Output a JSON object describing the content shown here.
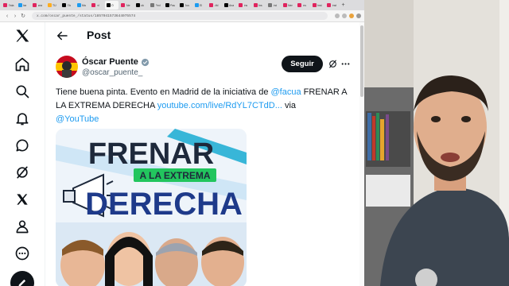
{
  "browser": {
    "tabs": [
      {
        "label": "Esta",
        "color": "#e0245e"
      },
      {
        "label": "las",
        "color": "#1d9bf0"
      },
      {
        "label": "sea",
        "color": "#e0245e"
      },
      {
        "label": "TÚ",
        "color": "#ffad1f"
      },
      {
        "label": "Elc",
        "color": "#000000"
      },
      {
        "label": "Ma",
        "color": "#1d9bf0"
      },
      {
        "label": "rd",
        "color": "#e0245e"
      },
      {
        "label": "Ó",
        "color": "#000000",
        "active": true
      },
      {
        "label": "Ale",
        "color": "#e0245e"
      },
      {
        "label": "clo",
        "color": "#000000"
      },
      {
        "label": "Fed",
        "color": "#777777"
      },
      {
        "label": "Pau",
        "color": "#000000"
      },
      {
        "label": "Jus",
        "color": "#000000"
      },
      {
        "label": "El",
        "color": "#1d9bf0"
      },
      {
        "label": "Vid",
        "color": "#e0245e"
      },
      {
        "label": "Ana",
        "color": "#000000"
      },
      {
        "label": "Ins",
        "color": "#e0245e"
      },
      {
        "label": "Ins",
        "color": "#e0245e"
      },
      {
        "label": "Ind",
        "color": "#777777"
      },
      {
        "label": "Nen",
        "color": "#e0245e"
      },
      {
        "label": "ins",
        "color": "#e0245e"
      },
      {
        "label": "Inst",
        "color": "#e0245e"
      },
      {
        "label": "Inst",
        "color": "#e0245e"
      }
    ],
    "new_tab": "+",
    "url": "x.com/oscar_puente_/status/1857041573644075574"
  },
  "nav": {
    "items": [
      {
        "name": "x-logo-icon"
      },
      {
        "name": "home-icon"
      },
      {
        "name": "search-icon"
      },
      {
        "name": "notifications-icon"
      },
      {
        "name": "messages-icon"
      },
      {
        "name": "grok-icon"
      },
      {
        "name": "premium-x-icon"
      },
      {
        "name": "profile-icon"
      },
      {
        "name": "more-icon"
      },
      {
        "name": "compose-icon"
      }
    ]
  },
  "post": {
    "header_title": "Post",
    "author_name": "Óscar Puente",
    "author_handle": "@oscar_puente_",
    "follow_label": "Seguir",
    "text_before": "Tiene buena pinta. Evento en Madrid de la iniciativa de ",
    "mention_facua": "@facua",
    "text_middle": " FRENAR A LA EXTREMA DERECHA ",
    "link_youtube": "youtube.com/live/RdYL7CTdD...",
    "text_via": " via",
    "mention_youtube": "@YouTube",
    "image": {
      "line1": "FRENAR",
      "line2": "A LA EXTREMA",
      "line3": "DERECHA"
    }
  },
  "colors": {
    "link": "#1d9bf0",
    "text": "#0f1419",
    "muted": "#536471",
    "image_blue": "#1e3a8a",
    "image_green": "#22c55e"
  }
}
